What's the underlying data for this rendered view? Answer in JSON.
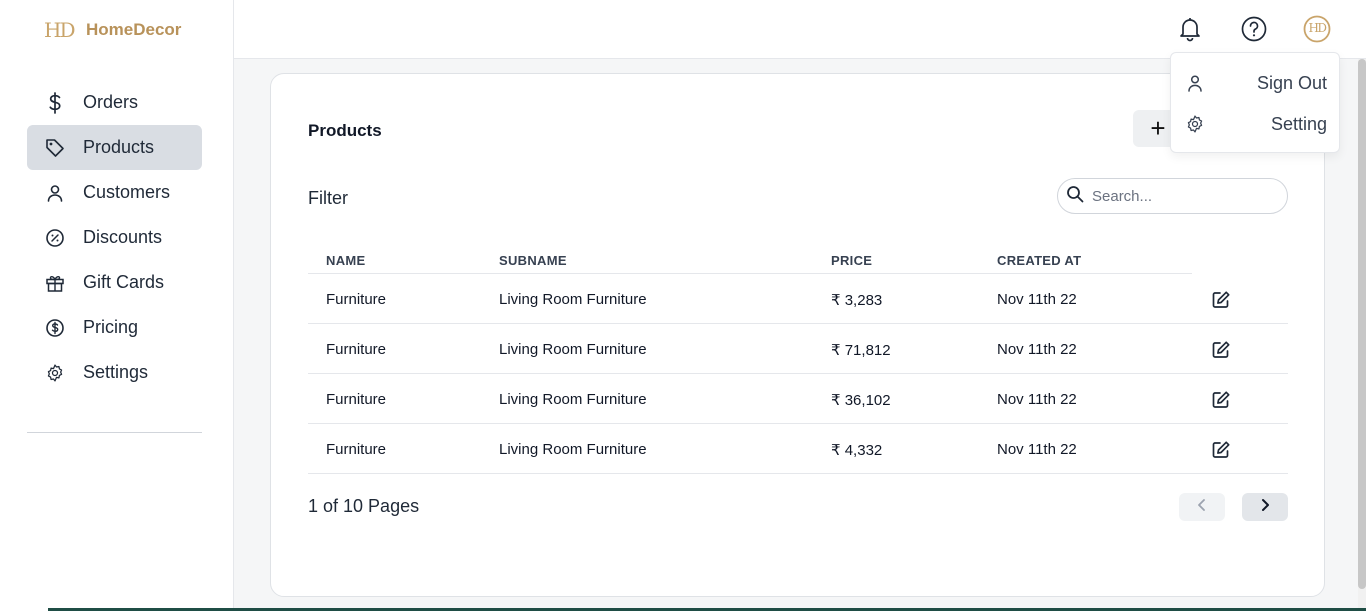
{
  "brand": {
    "mark": "HD",
    "name": "HomeDecor"
  },
  "sidebar": {
    "items": [
      {
        "label": "Orders",
        "icon": "dollar-icon",
        "active": false
      },
      {
        "label": "Products",
        "icon": "tag-icon",
        "active": true
      },
      {
        "label": "Customers",
        "icon": "user-icon",
        "active": false
      },
      {
        "label": "Discounts",
        "icon": "percent-badge-icon",
        "active": false
      },
      {
        "label": "Gift Cards",
        "icon": "gift-icon",
        "active": false
      },
      {
        "label": "Pricing",
        "icon": "dollar-circle-icon",
        "active": false
      },
      {
        "label": "Settings",
        "icon": "gear-icon",
        "active": false
      }
    ]
  },
  "topbar": {
    "avatar_initials": "HD"
  },
  "user_menu": {
    "items": [
      {
        "label": "Sign Out",
        "icon": "user-icon"
      },
      {
        "label": "Setting",
        "icon": "gear-icon"
      }
    ]
  },
  "products": {
    "title": "Products",
    "add_label": "+",
    "filter_label": "Filter",
    "search_placeholder": "Search...",
    "columns": [
      "NAME",
      "SUBNAME",
      "PRICE",
      "CREATED AT"
    ],
    "rows": [
      {
        "name": "Furniture",
        "subname": "Living Room Furniture",
        "price": "₹ 3,283",
        "created": "Nov 11th 22"
      },
      {
        "name": "Furniture",
        "subname": "Living Room Furniture",
        "price": "₹ 71,812",
        "created": "Nov 11th 22"
      },
      {
        "name": "Furniture",
        "subname": "Living Room Furniture",
        "price": "₹ 36,102",
        "created": "Nov 11th 22"
      },
      {
        "name": "Furniture",
        "subname": "Living Room Furniture",
        "price": "₹ 4,332",
        "created": "Nov 11th 22"
      }
    ],
    "pagination": {
      "text": "1 of 10 Pages"
    }
  },
  "colors": {
    "brand": "#b8925a",
    "active_nav": "#d9dde3"
  }
}
